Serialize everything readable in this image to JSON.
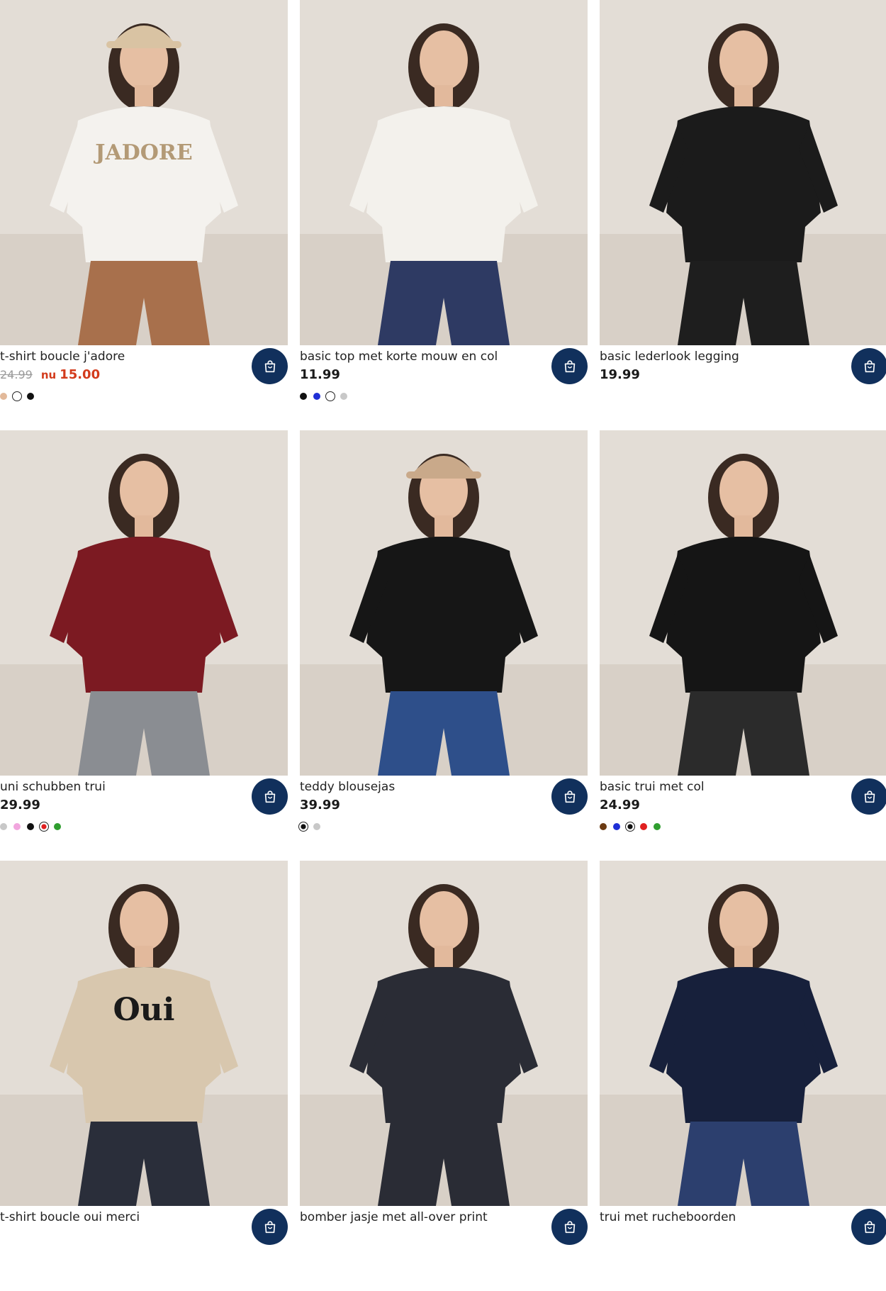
{
  "colors": {
    "cart_button": "#11305c",
    "sale": "#d33b1c",
    "old_price": "#9a9a9a"
  },
  "products": [
    {
      "name": "t-shirt boucle j'adore",
      "old_price": "24.99",
      "sale_prefix": "nu",
      "sale_price": "15.00",
      "price": "",
      "photo": {
        "top": "#f4f2ee",
        "bottom": "#a8704c",
        "print": "JADORE",
        "hat": "#d9c3a3"
      },
      "swatches": [
        {
          "color": "#e2b99a",
          "selected": false
        },
        {
          "color": "#ffffff",
          "selected": true
        },
        {
          "color": "#111111",
          "selected": false
        }
      ]
    },
    {
      "name": "basic top met korte mouw en col",
      "old_price": "",
      "sale_prefix": "",
      "sale_price": "",
      "price": "11.99",
      "photo": {
        "top": "#f3f1ec",
        "bottom": "#2e3a63",
        "print": "",
        "hat": ""
      },
      "swatches": [
        {
          "color": "#111111",
          "selected": false
        },
        {
          "color": "#1f2fd6",
          "selected": false
        },
        {
          "color": "#ffffff",
          "selected": true
        },
        {
          "color": "#c8c8c8",
          "selected": false
        }
      ]
    },
    {
      "name": "basic lederlook legging",
      "old_price": "",
      "sale_prefix": "",
      "sale_price": "",
      "price": "19.99",
      "photo": {
        "top": "#1b1b1b",
        "bottom": "#1e1e1e",
        "print": "",
        "hat": ""
      },
      "swatches": []
    },
    {
      "name": "uni schubben trui",
      "old_price": "",
      "sale_prefix": "",
      "sale_price": "",
      "price": "29.99",
      "photo": {
        "top": "#7c1a22",
        "bottom": "#8a8d92",
        "print": "",
        "hat": ""
      },
      "swatches": [
        {
          "color": "#c8c8c8",
          "selected": false
        },
        {
          "color": "#f1a6de",
          "selected": false
        },
        {
          "color": "#111111",
          "selected": false
        },
        {
          "color": "#e02020",
          "selected": true
        },
        {
          "color": "#2f9e2f",
          "selected": false
        }
      ]
    },
    {
      "name": "teddy blousejas",
      "old_price": "",
      "sale_prefix": "",
      "sale_price": "",
      "price": "39.99",
      "photo": {
        "top": "#161616",
        "bottom": "#2e4f8a",
        "print": "",
        "hat": "#c9a98a"
      },
      "swatches": [
        {
          "color": "#111111",
          "selected": true
        },
        {
          "color": "#c8c8c8",
          "selected": false
        }
      ]
    },
    {
      "name": "basic trui met col",
      "old_price": "",
      "sale_prefix": "",
      "sale_price": "",
      "price": "24.99",
      "photo": {
        "top": "#151515",
        "bottom": "#2b2b2b",
        "print": "",
        "hat": ""
      },
      "swatches": [
        {
          "color": "#6b3a12",
          "selected": false
        },
        {
          "color": "#1f2fd6",
          "selected": false
        },
        {
          "color": "#111111",
          "selected": true
        },
        {
          "color": "#e02020",
          "selected": false
        },
        {
          "color": "#2f9e2f",
          "selected": false
        }
      ]
    },
    {
      "name": "t-shirt boucle oui merci",
      "old_price": "",
      "sale_prefix": "",
      "sale_price": "",
      "price": "",
      "photo": {
        "top": "#d8c7ae",
        "bottom": "#2a2e3a",
        "print": "Oui",
        "hat": ""
      },
      "swatches": []
    },
    {
      "name": "bomber jasje met all-over print",
      "old_price": "",
      "sale_prefix": "",
      "sale_price": "",
      "price": "",
      "photo": {
        "top": "#2a2c35",
        "bottom": "#2a2c35",
        "print": "",
        "hat": ""
      },
      "swatches": []
    },
    {
      "name": "trui met rucheboorden",
      "old_price": "",
      "sale_prefix": "",
      "sale_price": "",
      "price": "",
      "photo": {
        "top": "#17203b",
        "bottom": "#2c3f6e",
        "print": "",
        "hat": ""
      },
      "swatches": []
    }
  ]
}
